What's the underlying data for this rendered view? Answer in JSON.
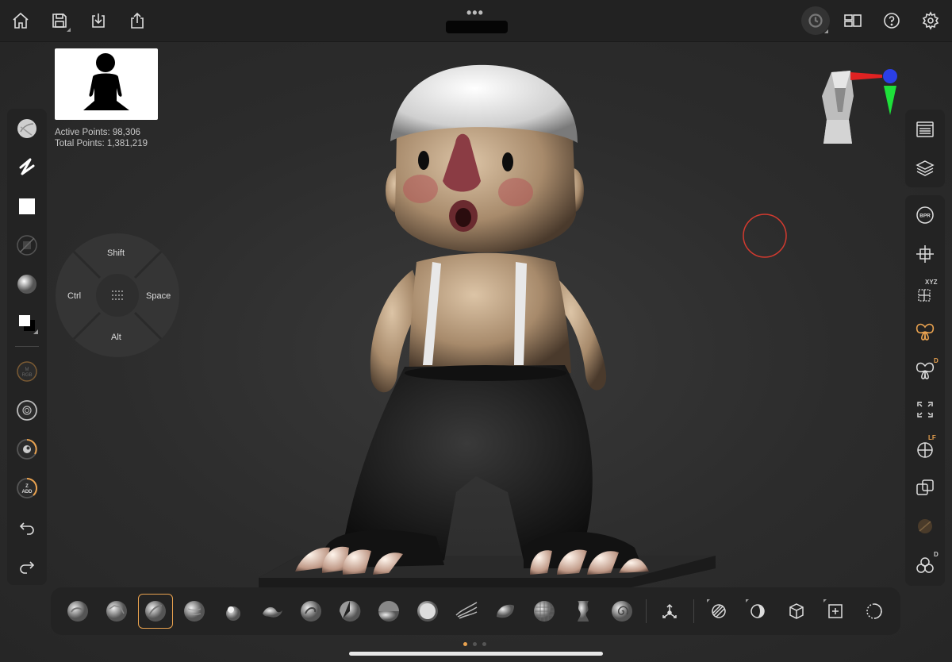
{
  "topbar": {
    "left_icons": [
      "home-icon",
      "save-icon",
      "import-icon",
      "share-icon"
    ],
    "menu_dots": "•••",
    "right_icons": [
      "history-icon",
      "layout-icon",
      "help-icon",
      "settings-icon"
    ]
  },
  "stats": {
    "active_points": "Active Points: 98,306",
    "total_points": "Total Points: 1,381,219"
  },
  "left_panel": {
    "icons": [
      "material-sphere-icon",
      "stroke-icon",
      "alpha-square-icon",
      "texture-disabled-icon",
      "matcap-sphere-icon",
      "color-swatch-icon",
      "rgb-intensity-icon",
      "draw-size-icon",
      "focal-shift-icon",
      "z-intensity-icon",
      "undo-icon",
      "redo-icon"
    ],
    "rgb_label": "M\nRGB",
    "z_label": "Z",
    "add_label": "ADD"
  },
  "modifier_dial": {
    "top": "Shift",
    "left": "Ctrl",
    "right": "Space",
    "bottom": "Alt",
    "center_icon": "keypad-icon"
  },
  "right_panel": {
    "top_icons": [
      "subtool-list-icon",
      "layers-icon"
    ],
    "icons": [
      "bpr-render-icon",
      "transform-gizmo-icon",
      "xyz-symmetry-icon",
      "symmetry-butterfly-icon",
      "dynamic-symmetry-icon",
      "frame-icon",
      "floor-grid-icon",
      "transparency-icon",
      "polyframe-icon",
      "solo-icon"
    ],
    "bpr_label": "BPR",
    "xyz_label": "XYZ",
    "d_label": "D",
    "lf_label": "LF",
    "d2_label": "D"
  },
  "bottom_bar": {
    "brushes": [
      "claybuildup-brush",
      "clay-brush",
      "standard-brush",
      "smooth-sphere-brush",
      "inflate-brush",
      "move-brush",
      "dam-standard-brush",
      "trim-dynamic-brush",
      "hpolish-brush",
      "flatten-brush",
      "snakehook-brush",
      "orb-brush",
      "mask-brush",
      "pinch-brush",
      "spiral-brush"
    ],
    "selected_index": 2,
    "tools": [
      "gizmo-icon",
      "draw-mode-icon",
      "edit-mode-icon",
      "cube-icon",
      "frame-mesh-icon",
      "dynamesh-icon"
    ]
  },
  "colors": {
    "accent": "#e9a24f",
    "panel": "#232323",
    "background": "#2b2b2b",
    "cursor_ring": "#d23a2f"
  }
}
